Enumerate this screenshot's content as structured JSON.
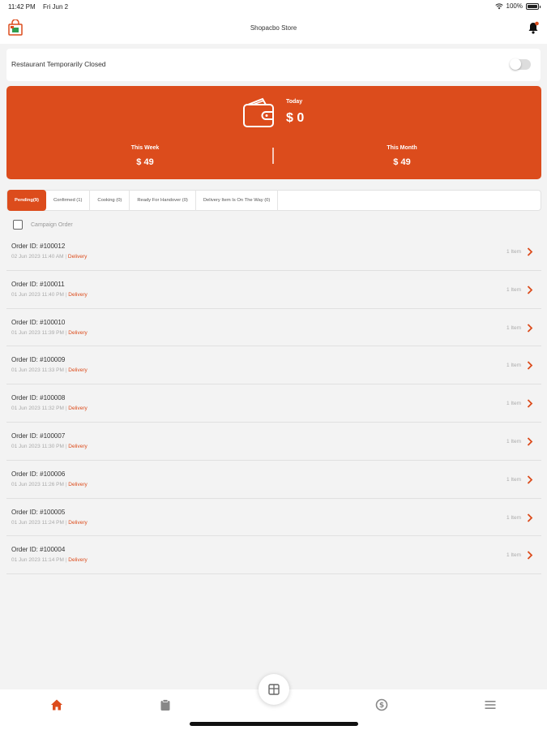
{
  "status_bar": {
    "time": "11:42 PM",
    "date": "Fri Jun 2",
    "battery": "100%"
  },
  "header": {
    "title": "Shopacbo Store"
  },
  "closed_toggle": {
    "label": "Restaurant Temporarily Closed",
    "enabled": false
  },
  "earnings": {
    "today_label": "Today",
    "today_value": "$ 0",
    "week_label": "This Week",
    "week_value": "$ 49",
    "month_label": "This Month",
    "month_value": "$ 49"
  },
  "tabs": [
    {
      "label": "Pending(9)",
      "active": true
    },
    {
      "label": "Confirmed (1)",
      "active": false
    },
    {
      "label": "Cooking (0)",
      "active": false
    },
    {
      "label": "Ready For Handover (0)",
      "active": false
    },
    {
      "label": "Delivery Item Is On The Way (0)",
      "active": false
    }
  ],
  "campaign": {
    "label": "Campaign Order",
    "checked": false
  },
  "orders": [
    {
      "id": "Order ID: #100012",
      "time": "02 Jun 2023 11:40 AM",
      "separator": "|",
      "type": "Delivery",
      "items": "1 Item"
    },
    {
      "id": "Order ID: #100011",
      "time": "01 Jun 2023 11:40 PM",
      "separator": "|",
      "type": "Delivery",
      "items": "1 Item"
    },
    {
      "id": "Order ID: #100010",
      "time": "01 Jun 2023 11:39 PM",
      "separator": "|",
      "type": "Delivery",
      "items": "1 Item"
    },
    {
      "id": "Order ID: #100009",
      "time": "01 Jun 2023 11:33 PM",
      "separator": "|",
      "type": "Delivery",
      "items": "1 Item"
    },
    {
      "id": "Order ID: #100008",
      "time": "01 Jun 2023 11:32 PM",
      "separator": "|",
      "type": "Delivery",
      "items": "1 Item"
    },
    {
      "id": "Order ID: #100007",
      "time": "01 Jun 2023 11:30 PM",
      "separator": "|",
      "type": "Delivery",
      "items": "1 Item"
    },
    {
      "id": "Order ID: #100006",
      "time": "01 Jun 2023 11:26 PM",
      "separator": "|",
      "type": "Delivery",
      "items": "1 Item"
    },
    {
      "id": "Order ID: #100005",
      "time": "01 Jun 2023 11:24 PM",
      "separator": "|",
      "type": "Delivery",
      "items": "1 Item"
    },
    {
      "id": "Order ID: #100004",
      "time": "01 Jun 2023 11:14 PM",
      "separator": "|",
      "type": "Delivery",
      "items": "1 Item"
    }
  ],
  "bottom_nav": [
    {
      "icon": "home-icon",
      "active": true
    },
    {
      "icon": "clipboard-icon",
      "active": false
    },
    {
      "icon": "pos-icon",
      "active": false
    },
    {
      "icon": "dollar-icon",
      "active": false
    },
    {
      "icon": "menu-icon",
      "active": false
    }
  ],
  "colors": {
    "accent": "#dc4c1c",
    "background": "#f3f3f3",
    "inactive_icon": "#888888"
  }
}
